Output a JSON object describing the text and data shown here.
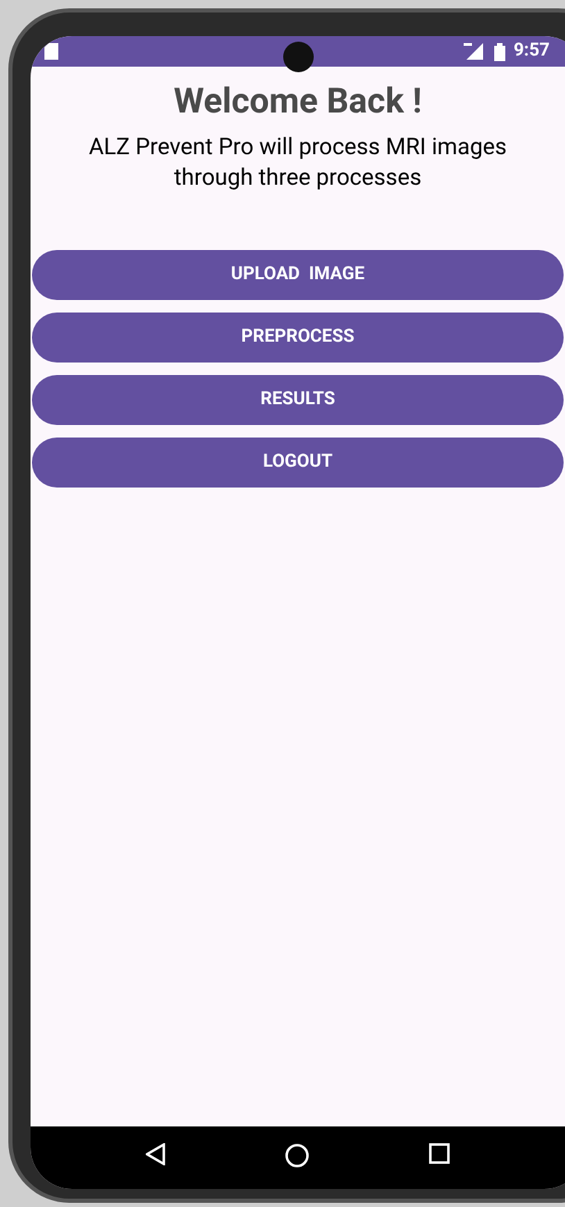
{
  "status_bar": {
    "time": "9:57"
  },
  "header": {
    "title": "Welcome Back !",
    "subtitle": "ALZ Prevent Pro will process MRI images through three processes"
  },
  "buttons": [
    {
      "label": "UPLOAD  IMAGE"
    },
    {
      "label": "PREPROCESS"
    },
    {
      "label": "RESULTS"
    },
    {
      "label": "LOGOUT"
    }
  ]
}
